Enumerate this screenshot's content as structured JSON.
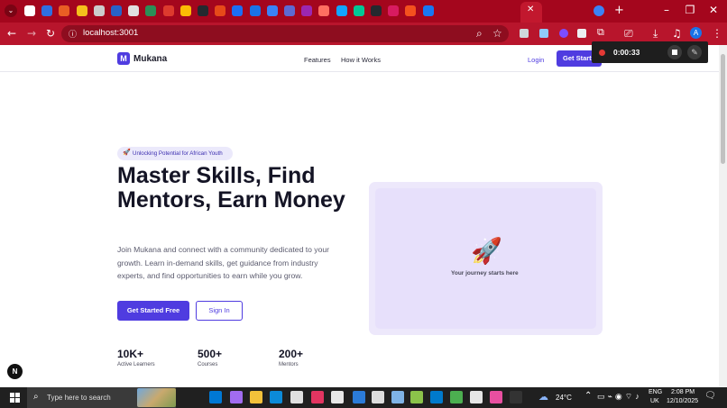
{
  "browser": {
    "address_url": "localhost:3001",
    "tab_favicons": [
      "#ffffff",
      "#2f6fe0",
      "#e95e24",
      "#f5c01c",
      "#cccccc",
      "#2862c7",
      "#e0e0e0",
      "#2b8f57",
      "#dd3a2e",
      "#fbbc04",
      "#24292f",
      "#e64a19",
      "#1b6ef3",
      "#1a73e8",
      "#3b82f6",
      "#5e6ad2",
      "#9c27b0",
      "#ff6f61",
      "#12a4ff",
      "#00c896",
      "#24292f",
      "#d81b60",
      "#f4511e",
      "#1877f2",
      "#3b82f6"
    ],
    "toolbar_icons": [
      "back-icon",
      "forward-icon",
      "reload-icon",
      "info-icon",
      "zoom-icon",
      "star-icon",
      "extensions-icon",
      "download-icon",
      "profile-icon",
      "menu-icon"
    ]
  },
  "recorder": {
    "time": "0:00:33"
  },
  "nav": {
    "logo_letter": "M",
    "brand": "Mukana",
    "links": [
      "Features",
      "How it Works"
    ],
    "login": "Login",
    "cta": "Get Started"
  },
  "hero": {
    "badge_emoji": "🚀",
    "badge": "Unlocking Potential for African Youth",
    "heading": "Master Skills, Find Mentors, Earn Money",
    "description": "Join Mukana and connect with a community dedicated to your growth. Learn in-demand skills, get guidance from industry experts, and find opportunities to earn while you grow.",
    "primary_button": "Get Started Free",
    "secondary_button": "Sign In",
    "stats": [
      {
        "value": "10K+",
        "label": "Active Learners"
      },
      {
        "value": "500+",
        "label": "Courses"
      },
      {
        "value": "200+",
        "label": "Mentors"
      }
    ],
    "card_emoji": "🚀",
    "card_caption": "Your journey starts here"
  },
  "dev_badge": "N",
  "taskbar": {
    "search_placeholder": "Type here to search",
    "weather": "24°C",
    "lang_1": "ENG",
    "lang_2": "UK",
    "time": "2:08 PM",
    "date": "12/10/2025"
  },
  "colors": {
    "accent": "#4f3ce0",
    "tabstrip": "#a4061d",
    "toolbar": "#b8152c"
  }
}
